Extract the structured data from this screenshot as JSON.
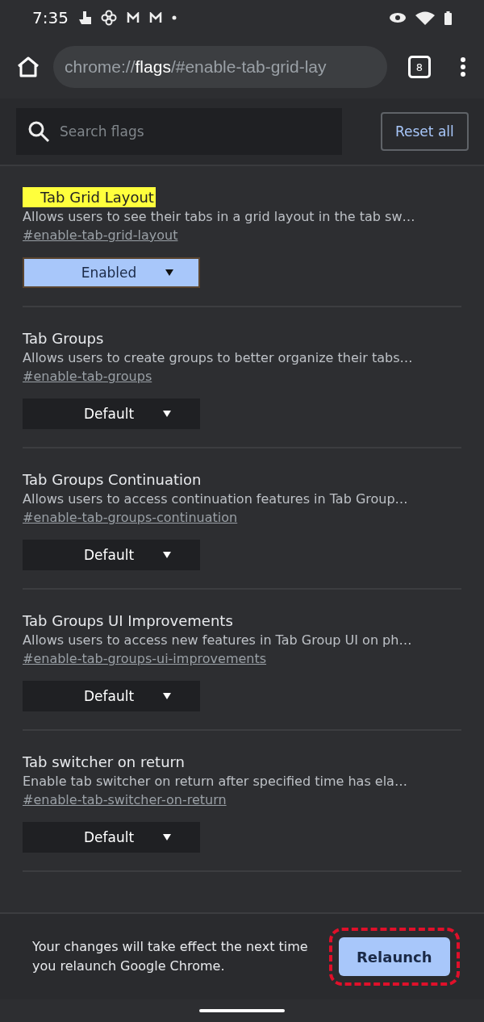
{
  "status_bar": {
    "time": "7:35"
  },
  "toolbar": {
    "url_host": "chrome://",
    "url_bold": "flags",
    "url_rest": "/#enable-tab-grid-lay",
    "tab_count": "8"
  },
  "search": {
    "placeholder": "Search flags"
  },
  "reset_button": "Reset all",
  "flags": [
    {
      "title": "Tab Grid Layout",
      "highlighted": true,
      "description": "Allows users to see their tabs in a grid layout in the tab sw…",
      "link": "#enable-tab-grid-layout",
      "value": "Enabled",
      "changed": true
    },
    {
      "title": "Tab Groups",
      "highlighted": false,
      "description": "Allows users to create groups to better organize their tabs…",
      "link": "#enable-tab-groups",
      "value": "Default",
      "changed": false
    },
    {
      "title": "Tab Groups Continuation",
      "highlighted": false,
      "description": "Allows users to access continuation features in Tab Group…",
      "link": "#enable-tab-groups-continuation",
      "value": "Default",
      "changed": false
    },
    {
      "title": "Tab Groups UI Improvements",
      "highlighted": false,
      "description": "Allows users to access new features in Tab Group UI on ph…",
      "link": "#enable-tab-groups-ui-improvements",
      "value": "Default",
      "changed": false
    },
    {
      "title": "Tab switcher on return",
      "highlighted": false,
      "description": "Enable tab switcher on return after specified time has ela…",
      "link": "#enable-tab-switcher-on-return",
      "value": "Default",
      "changed": false
    }
  ],
  "relaunch_bar": {
    "message": "Your changes will take effect the next time you relaunch Google Chrome.",
    "button": "Relaunch",
    "button_highlighted": true
  }
}
